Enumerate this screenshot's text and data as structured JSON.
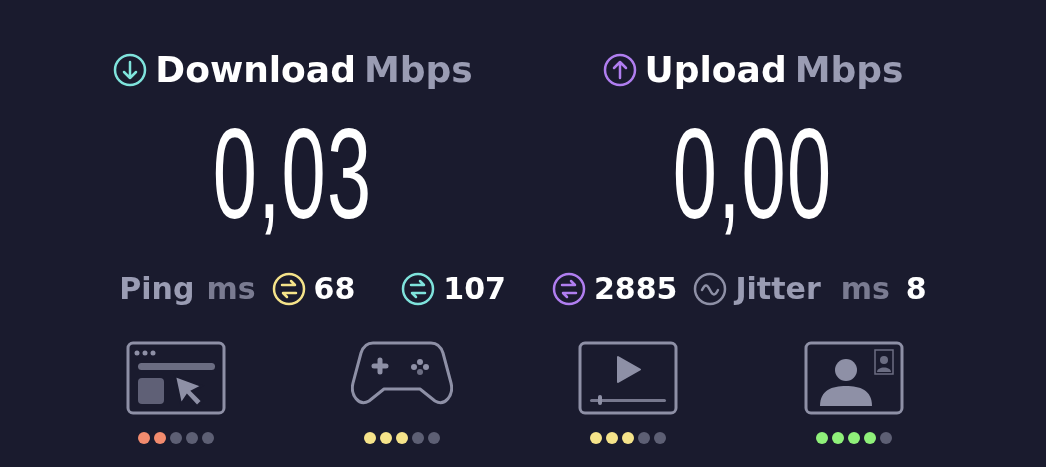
{
  "download": {
    "label": "Download",
    "unit": "Mbps",
    "value": "0,03",
    "color": "#7fe3dc"
  },
  "upload": {
    "label": "Upload",
    "unit": "Mbps",
    "value": "0,00",
    "color": "#b07ef0"
  },
  "ping": {
    "label": "Ping",
    "unit": "ms",
    "readings": [
      {
        "value": "68",
        "color": "#f5e38a"
      },
      {
        "value": "107",
        "color": "#7fe3dc"
      },
      {
        "value": "2885",
        "color": "#b07ef0"
      }
    ]
  },
  "jitter": {
    "label": "Jitter",
    "unit": "ms",
    "value": "8"
  },
  "activities": [
    {
      "kind": "browsing",
      "stars": 2,
      "color": "#f28b6e"
    },
    {
      "kind": "gaming",
      "stars": 3,
      "color": "#f5e38a"
    },
    {
      "kind": "streaming",
      "stars": 3,
      "color": "#f5e38a"
    },
    {
      "kind": "video-call",
      "stars": 4,
      "color": "#8ff07a"
    }
  ]
}
